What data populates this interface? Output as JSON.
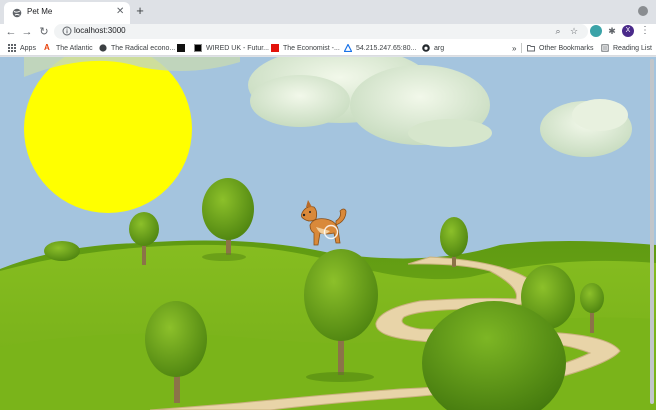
{
  "tab": {
    "title": "Pet Me",
    "close_icon": "close-icon",
    "favicon": "globe-icon"
  },
  "new_tab_icon": "plus-icon",
  "toolbar": {
    "url": "localhost:3000",
    "back_icon": "arrow-left-icon",
    "forward_icon": "arrow-right-icon",
    "reload_icon": "reload-icon"
  },
  "profile": {
    "initial": "X"
  },
  "bookmarks": {
    "items": [
      {
        "label": "Apps",
        "icon": "apps-grid-icon",
        "color": "#5f6368"
      },
      {
        "label": "The Atlantic",
        "icon": "atlantic-a-icon",
        "color": "#e8410b"
      },
      {
        "label": "The Radical econo...",
        "icon": "globe-icon",
        "color": "#3c4043"
      },
      {
        "label": "WIRED UK - Futur...",
        "icon": "wired-icon",
        "color": "#000000"
      },
      {
        "label": "The Economist -...",
        "icon": "economist-icon",
        "color": "#e3120b"
      },
      {
        "label": "54.215.247.65:80...",
        "icon": "triangle-icon",
        "color": "#1a73e8"
      },
      {
        "label": "arg",
        "icon": "github-icon",
        "color": "#24292e"
      }
    ],
    "other": "Other Bookmarks",
    "reading_list": "Reading List"
  },
  "scene": {
    "sky_color": "#a4c4de",
    "sun_color": "#ffff00",
    "grass_color": "#7bb51a",
    "path_color": "#e8d4a8",
    "tree_color": "#5f9b16",
    "trunk_color": "#8b7348",
    "pet": "dog"
  }
}
